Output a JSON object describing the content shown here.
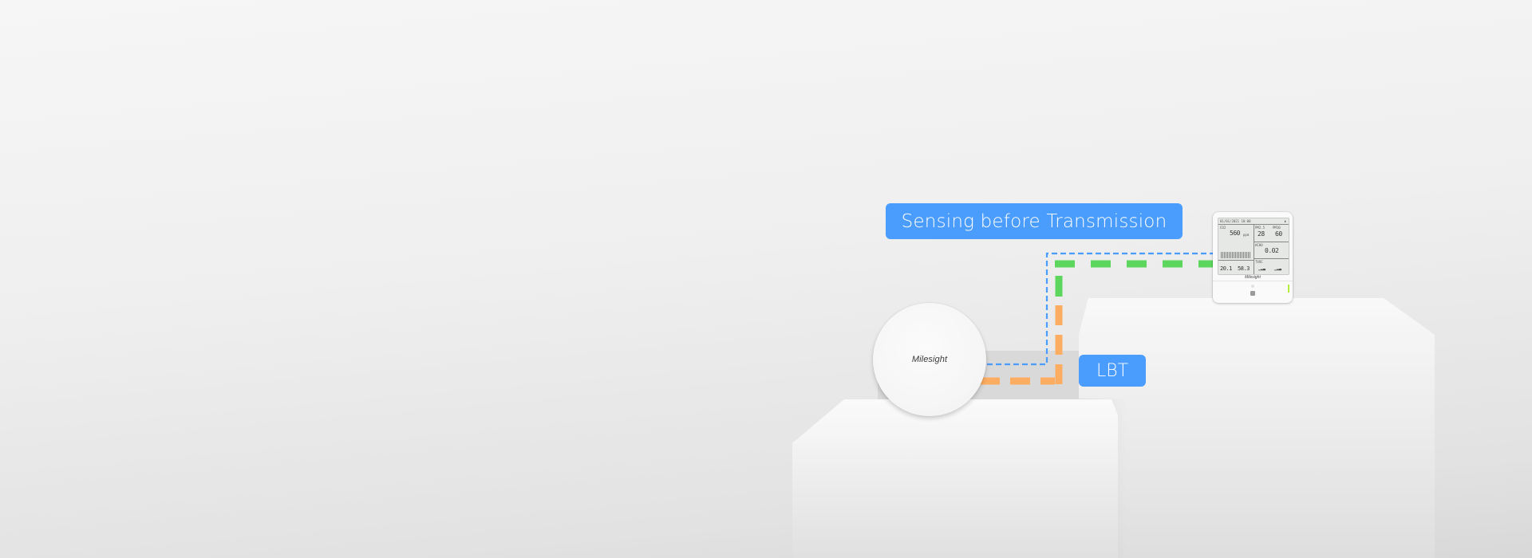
{
  "scene": {
    "description": "LoRaWAN Listen-Before-Talk illustration",
    "labels": {
      "sensing": "Sensing before Transmission",
      "lbt": "LBT"
    },
    "gateway": {
      "brand": "Milesight"
    },
    "device": {
      "brand": "Milesight",
      "screen": {
        "datetime": "01/01/2021 10:00",
        "signal": "all",
        "co2_label": "CO2",
        "co2_value": "560",
        "co2_unit": "ppm",
        "pm25_label": "PM2.5",
        "pm25_value": "28",
        "pm10_label": "PM10",
        "pm10_value": "60",
        "hcho_label": "HCHO",
        "hcho_value": "0.02",
        "temperature_value": "20.1",
        "humidity_value": "58.3",
        "tvoc_label": "TVOC"
      }
    },
    "lines": {
      "sensing_color": "#4a9cfd",
      "clear_channel_color": "#5cd65c",
      "busy_channel_color": "#fdad62"
    },
    "colors": {
      "tag_background": "#4a9cfd",
      "tag_text": "#ffffff"
    }
  }
}
